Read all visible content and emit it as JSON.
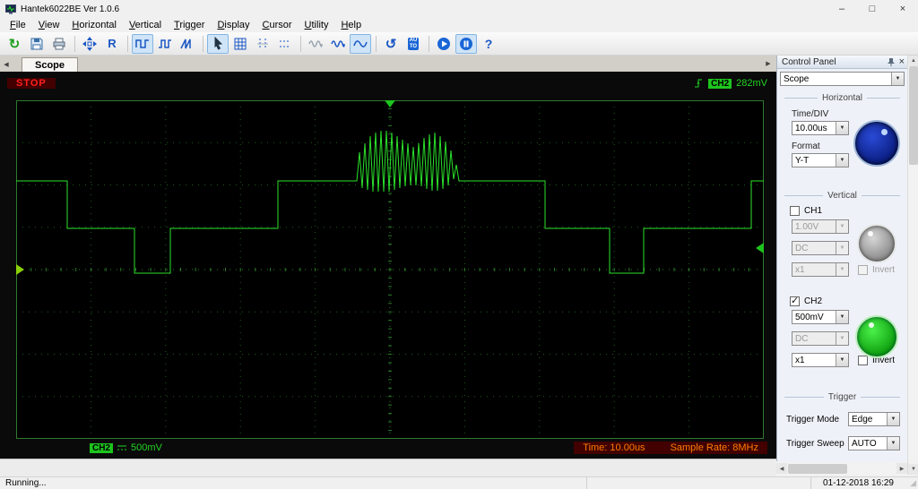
{
  "window": {
    "title": "Hantek6022BE Ver 1.0.6",
    "minimize": "–",
    "maximize": "□",
    "close": "×"
  },
  "menu": {
    "items": [
      "File",
      "View",
      "Horizontal",
      "Vertical",
      "Trigger",
      "Display",
      "Cursor",
      "Utility",
      "Help"
    ]
  },
  "toolbar": {
    "glyphs": {
      "refresh": "↻",
      "reference": "R",
      "undo": "↺",
      "auto": "AUTO",
      "help": "?"
    }
  },
  "tabs": {
    "scope": "Scope",
    "left_arrow": "◀",
    "right_arrow": "▶"
  },
  "scope": {
    "status": "STOP",
    "trigger_channel": "CH2",
    "trigger_level": "282mV",
    "channel_badge": "CH2",
    "channel_volts": "500mV",
    "time": "Time: 10.00us",
    "sample_rate": "Sample Rate: 8MHz",
    "grid": {
      "cols": 10,
      "rows": 8
    },
    "waveform": [
      [
        0,
        90
      ],
      [
        57,
        90
      ],
      [
        57,
        143
      ],
      [
        132,
        143
      ],
      [
        132,
        193
      ],
      [
        172,
        193
      ],
      [
        172,
        143
      ],
      [
        292,
        143
      ],
      [
        292,
        90
      ],
      [
        380,
        90
      ],
      [
        383,
        58
      ],
      [
        386,
        98
      ],
      [
        389,
        48
      ],
      [
        392,
        100
      ],
      [
        395,
        40
      ],
      [
        398,
        102
      ],
      [
        401,
        36
      ],
      [
        404,
        102
      ],
      [
        407,
        34
      ],
      [
        410,
        102
      ],
      [
        413,
        34
      ],
      [
        416,
        102
      ],
      [
        419,
        36
      ],
      [
        422,
        100
      ],
      [
        425,
        40
      ],
      [
        428,
        98
      ],
      [
        431,
        44
      ],
      [
        434,
        96
      ],
      [
        437,
        48
      ],
      [
        440,
        95
      ],
      [
        443,
        52
      ],
      [
        446,
        95
      ],
      [
        449,
        48
      ],
      [
        452,
        96
      ],
      [
        455,
        42
      ],
      [
        458,
        99
      ],
      [
        461,
        38
      ],
      [
        464,
        101
      ],
      [
        467,
        36
      ],
      [
        470,
        101
      ],
      [
        473,
        40
      ],
      [
        476,
        99
      ],
      [
        479,
        46
      ],
      [
        482,
        95
      ],
      [
        485,
        56
      ],
      [
        488,
        88
      ],
      [
        491,
        72
      ],
      [
        494,
        90
      ],
      [
        590,
        90
      ],
      [
        590,
        143
      ],
      [
        662,
        143
      ],
      [
        662,
        193
      ],
      [
        700,
        193
      ],
      [
        700,
        143
      ],
      [
        820,
        143
      ],
      [
        820,
        90
      ],
      [
        834,
        90
      ]
    ]
  },
  "control_panel": {
    "title": "Control Panel",
    "close": "×",
    "mode_select": "Scope",
    "horizontal": {
      "title": "Horizontal",
      "time_div_label": "Time/DIV",
      "time_div_value": "10.00us",
      "format_label": "Format",
      "format_value": "Y-T"
    },
    "vertical": {
      "title": "Vertical",
      "ch1": {
        "label": "CH1",
        "volts": "1.00V",
        "coupling": "DC",
        "probe": "x1",
        "invert_label": "Invert"
      },
      "ch2": {
        "label": "CH2",
        "volts": "500mV",
        "coupling": "DC",
        "probe": "x1",
        "invert_label": "Invert"
      }
    },
    "trigger": {
      "title": "Trigger",
      "mode_label": "Trigger Mode",
      "mode_value": "Edge",
      "sweep_label": "Trigger Sweep",
      "sweep_value": "AUTO"
    }
  },
  "statusbar": {
    "status": "Running...",
    "datetime": "01-12-2018 16:29"
  }
}
